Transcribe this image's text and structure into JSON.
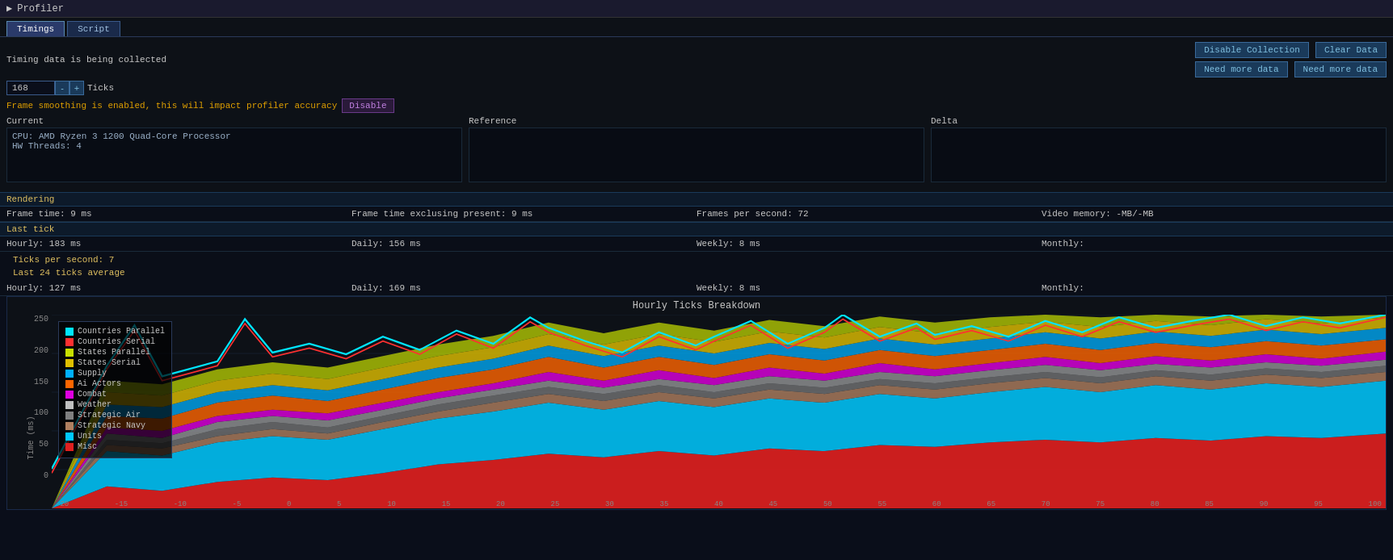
{
  "titleBar": {
    "icon": "▶",
    "title": "Profiler"
  },
  "tabs": [
    {
      "label": "Timings",
      "active": true
    },
    {
      "label": "Script",
      "active": false
    }
  ],
  "statusText": "Timing data is being collected",
  "ticksValue": "168",
  "ticksLabel": "Ticks",
  "smoothingWarning": "Frame smoothing is enabled, this will impact profiler accuracy",
  "disableButton": "Disable",
  "buttons": {
    "disableCollection": "Disable Collection",
    "needMoreData1": "Need more data",
    "clearData": "Clear Data",
    "needMoreData2": "Need more data"
  },
  "panels": {
    "current": {
      "label": "Current",
      "line1": "CPU: AMD Ryzen 3 1200 Quad-Core Processor",
      "line2": "HW Threads: 4"
    },
    "reference": {
      "label": "Reference",
      "content": ""
    },
    "delta": {
      "label": "Delta",
      "content": ""
    }
  },
  "rendering": {
    "sectionLabel": "Rendering",
    "frameTime": "Frame time: 9 ms",
    "frameTimeExcluding": "Frame time exclusing present: 9 ms",
    "framesPerSecond": "Frames per second: 72",
    "videoMemory": "Video memory: -MB/-MB"
  },
  "lastTick": {
    "sectionLabel": "Last tick",
    "hourly": "Hourly: 183 ms",
    "daily": "Daily: 156 ms",
    "weekly": "Weekly: 8 ms",
    "monthly": "Monthly:"
  },
  "ticksPerSecond": {
    "label": "Ticks per second: 7",
    "avgLabel": "Last 24 ticks average"
  },
  "last24Ticks": {
    "hourly": "Hourly: 127 ms",
    "daily": "Daily: 169 ms",
    "weekly": "Weekly: 8 ms",
    "monthly": "Monthly:"
  },
  "chart": {
    "title": "Hourly Ticks Breakdown",
    "yAxisLabel": "Time (ms)",
    "yAxisValues": [
      "250",
      "200",
      "150",
      "100",
      "50",
      "0"
    ],
    "xAxisValues": [
      "-20",
      "-15",
      "-10",
      "-5",
      "0",
      "5",
      "10",
      "15",
      "20",
      "25",
      "30",
      "35",
      "40",
      "45",
      "50",
      "55",
      "60",
      "65",
      "70",
      "75",
      "80",
      "85",
      "90",
      "95",
      "100"
    ],
    "legend": [
      {
        "label": "Countries Parallel",
        "color": "#00e5ff"
      },
      {
        "label": "Countries Serial",
        "color": "#ff3030"
      },
      {
        "label": "States Parallel",
        "color": "#c8e000"
      },
      {
        "label": "States Serial",
        "color": "#e0c000"
      },
      {
        "label": "Supply",
        "color": "#00b0ff"
      },
      {
        "label": "Ai Actors",
        "color": "#ff6600"
      },
      {
        "label": "Combat",
        "color": "#e000e0"
      },
      {
        "label": "Weather",
        "color": "#c0c0c0"
      },
      {
        "label": "Strategic Air",
        "color": "#808080"
      },
      {
        "label": "Strategic Navy",
        "color": "#b08060"
      },
      {
        "label": "Units",
        "color": "#00c8ff"
      },
      {
        "label": "Misc",
        "color": "#e02020"
      }
    ]
  }
}
